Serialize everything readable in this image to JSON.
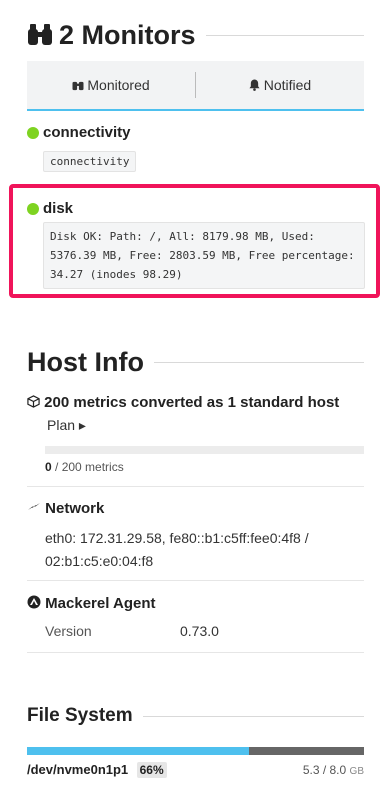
{
  "monitors": {
    "title": "2 Monitors",
    "tabs": [
      {
        "label": "Monitored",
        "icon": "binoculars-icon"
      },
      {
        "label": "Notified",
        "icon": "bell-icon"
      }
    ],
    "items": [
      {
        "name": "connectivity",
        "message": "connectivity",
        "status_color": "#7ed321"
      },
      {
        "name": "disk",
        "message": "Disk OK: Path: /, All: 8179.98 MB, Used: 5376.39 MB, Free: 2803.59 MB, Free percentage: 34.27 (inodes 98.29)",
        "status_color": "#7ed321"
      }
    ]
  },
  "host_info": {
    "title": "Host Info",
    "metrics": {
      "heading": "200 metrics converted as 1 standard host",
      "plan_label": "Plan ▸",
      "used": "0",
      "total_text": "/ 200 metrics",
      "usage_fraction": 0
    },
    "network": {
      "heading": "Network",
      "value": "eth0: 172.31.29.58, fe80::b1:c5ff:fee0:4f8 / 02:b1:c5:e0:04:f8"
    },
    "agent": {
      "heading": "Mackerel Agent",
      "version_label": "Version",
      "version_value": "0.73.0"
    }
  },
  "file_system": {
    "title": "File System",
    "device": "/dev/nvme0n1p1",
    "percent": "66%",
    "usage_fraction": 0.66,
    "used": "5.3",
    "total": "/ 8.0",
    "unit": "GB"
  },
  "colors": {
    "accent": "#4ec0ee",
    "ok": "#7ed321",
    "highlight": "#f0145a"
  }
}
